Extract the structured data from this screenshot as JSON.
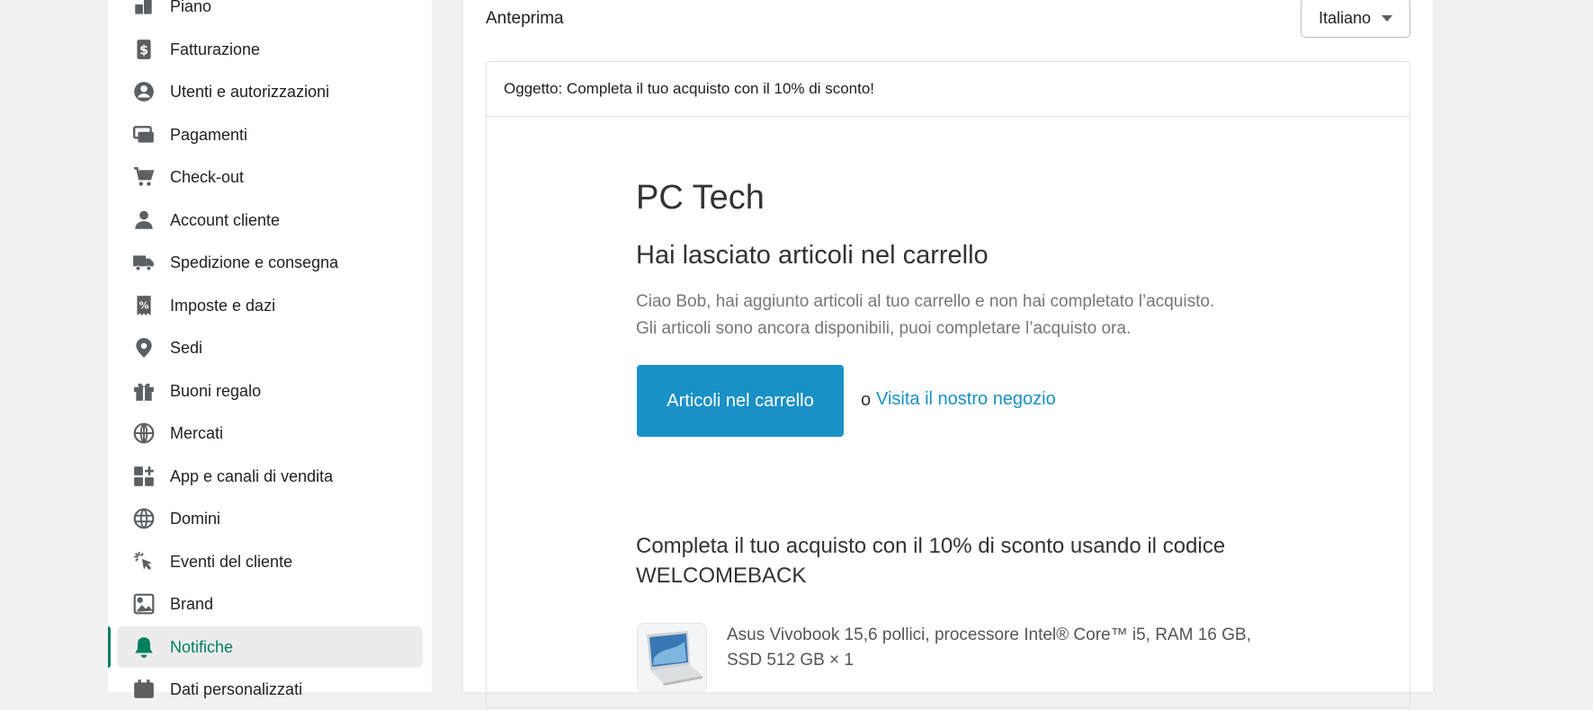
{
  "sidebar": {
    "items": [
      {
        "label": "Piano",
        "icon": "plan-icon"
      },
      {
        "label": "Fatturazione",
        "icon": "billing-icon"
      },
      {
        "label": "Utenti e autorizzazioni",
        "icon": "user-circle-icon"
      },
      {
        "label": "Pagamenti",
        "icon": "payments-icon"
      },
      {
        "label": "Check-out",
        "icon": "cart-icon"
      },
      {
        "label": "Account cliente",
        "icon": "person-icon"
      },
      {
        "label": "Spedizione e consegna",
        "icon": "truck-icon"
      },
      {
        "label": "Imposte e dazi",
        "icon": "tax-receipt-icon"
      },
      {
        "label": "Sedi",
        "icon": "location-pin-icon"
      },
      {
        "label": "Buoni regalo",
        "icon": "gift-icon"
      },
      {
        "label": "Mercati",
        "icon": "globe-icon"
      },
      {
        "label": "App e canali di vendita",
        "icon": "apps-icon"
      },
      {
        "label": "Domini",
        "icon": "domain-globe-icon"
      },
      {
        "label": "Eventi del cliente",
        "icon": "cursor-click-icon"
      },
      {
        "label": "Brand",
        "icon": "brand-image-icon"
      },
      {
        "label": "Notifiche",
        "icon": "bell-icon",
        "active": true
      },
      {
        "label": "Dati personalizzati",
        "icon": "custom-data-icon"
      }
    ],
    "active_color": "#008060"
  },
  "preview": {
    "title": "Anteprima",
    "language": "Italiano",
    "subject": "Oggetto: Completa il tuo acquisto con il 10% di sconto!"
  },
  "email": {
    "shop_name": "PC Tech",
    "heading": "Hai lasciato articoli nel carrello",
    "body_line1": "Ciao Bob, hai aggiunto articoli al tuo carrello e non hai completato l’acquisto.",
    "body_line2": "Gli articoli sono ancora disponibili, puoi completare l’acquisto ora.",
    "cta_label": "Articoli nel carrello",
    "or_text": "o",
    "link_label": "Visita il nostro negozio",
    "discount_heading": "Completa il tuo acquisto con il 10% di sconto usando il codice WELCOMEBACK",
    "product": {
      "title": "Asus Vivobook 15,6 pollici, processore Intel® Core™ i5, RAM 16 GB, SSD 512 GB × 1"
    },
    "accent_color": "#1990c6"
  }
}
